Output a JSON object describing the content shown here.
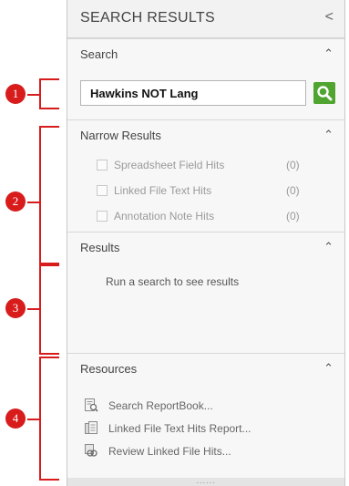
{
  "panel": {
    "title": "SEARCH RESULTS",
    "collapse_glyph": "<"
  },
  "search": {
    "section_title": "Search",
    "query_value": "Hawkins NOT Lang",
    "button_icon": "search-icon",
    "button_color": "#4fa52f"
  },
  "narrow": {
    "section_title": "Narrow Results",
    "items": [
      {
        "label": "Spreadsheet Field Hits",
        "count": "(0)"
      },
      {
        "label": "Linked File Text Hits",
        "count": "(0)"
      },
      {
        "label": "Annotation Note Hits",
        "count": "(0)"
      }
    ]
  },
  "results": {
    "section_title": "Results",
    "empty_message": "Run a search to see results"
  },
  "resources": {
    "section_title": "Resources",
    "items": [
      {
        "label": "Search ReportBook...",
        "icon": "report-search-icon"
      },
      {
        "label": "Linked File Text Hits Report...",
        "icon": "document-report-icon"
      },
      {
        "label": "Review Linked File Hits...",
        "icon": "linked-file-review-icon"
      }
    ]
  },
  "grip_text": "......",
  "annotations": {
    "color": "#d81c1c",
    "labels": [
      "1",
      "2",
      "3",
      "4"
    ]
  }
}
